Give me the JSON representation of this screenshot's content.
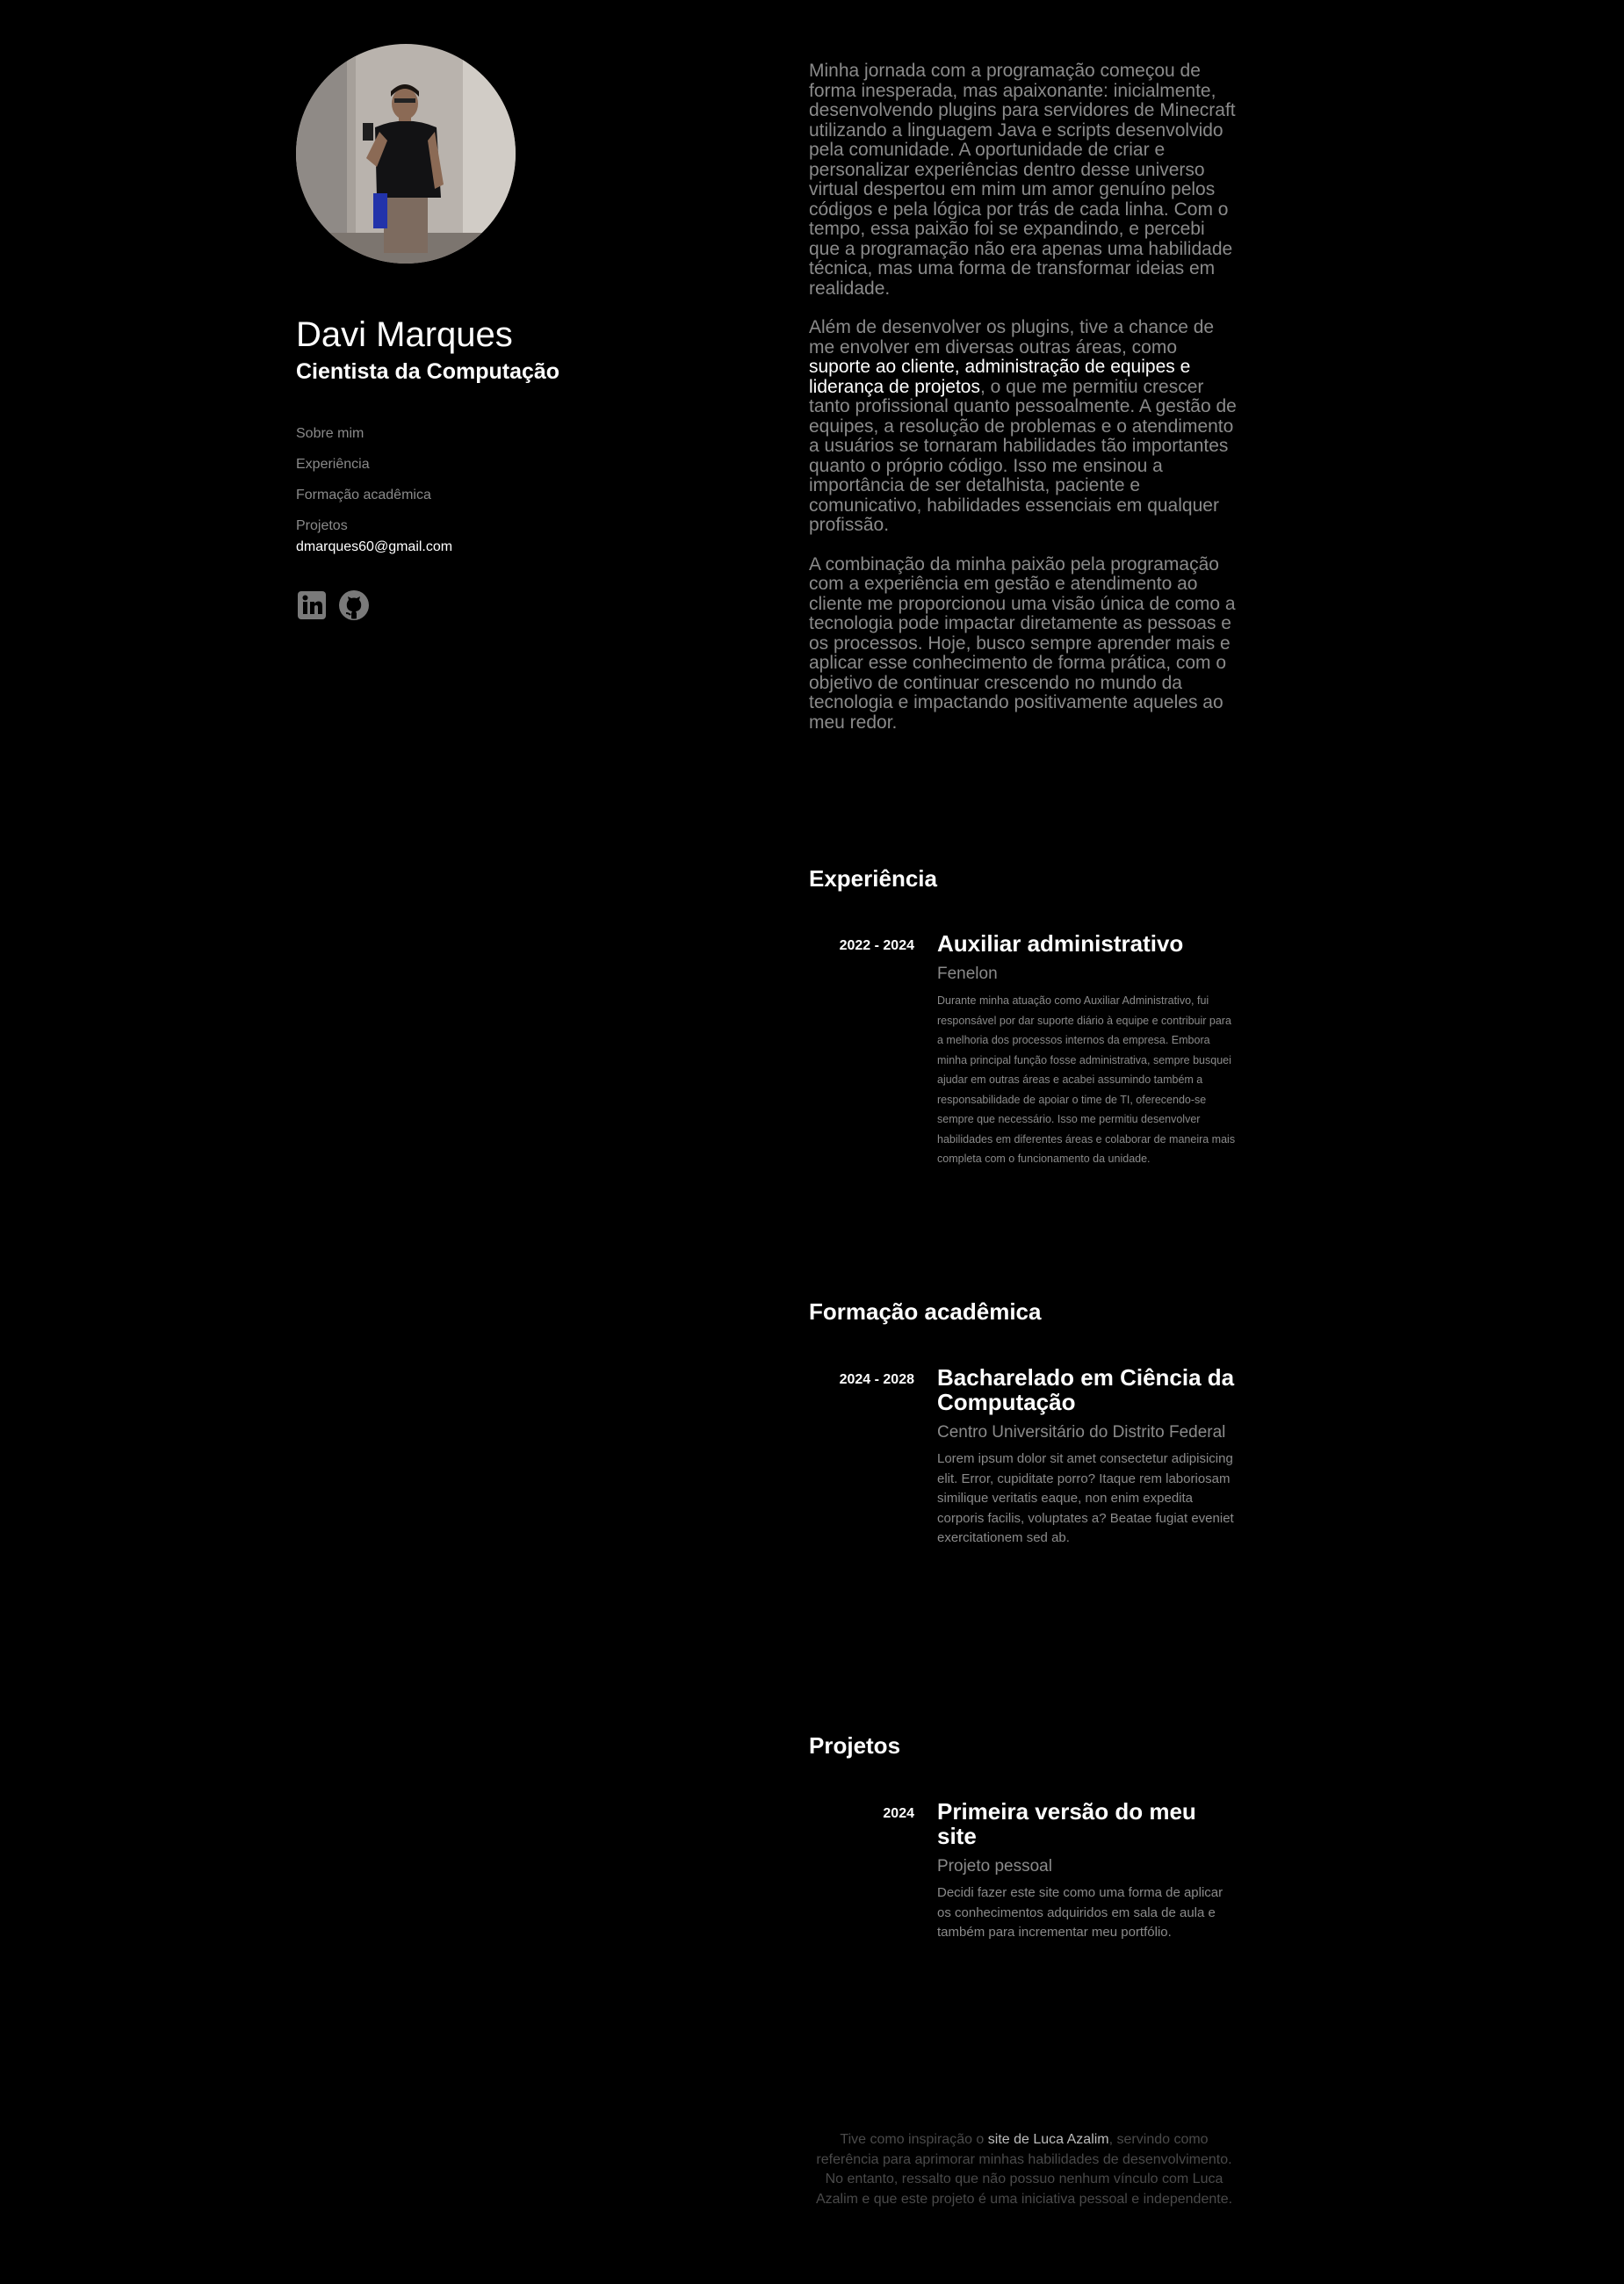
{
  "profile": {
    "name": "Davi Marques",
    "role": "Cientista da Computação",
    "email": "dmarques60@gmail.com"
  },
  "nav": {
    "items": [
      {
        "label": "Sobre mim"
      },
      {
        "label": "Experiência"
      },
      {
        "label": "Formação acadêmica"
      },
      {
        "label": "Projetos"
      }
    ]
  },
  "socials": [
    {
      "icon": "linkedin-icon"
    },
    {
      "icon": "github-icon"
    }
  ],
  "about": {
    "p1": "Minha jornada com a programação começou de forma inesperada, mas apaixonante: inicialmente, desenvolvendo plugins para servidores de Minecraft utilizando a linguagem Java e scripts desenvolvido pela comunidade. A oportunidade de criar e personalizar experiências dentro desse universo virtual despertou em mim um amor genuíno pelos códigos e pela lógica por trás de cada linha. Com o tempo, essa paixão foi se expandindo, e percebi que a programação não era apenas uma habilidade técnica, mas uma forma de transformar ideias em realidade.",
    "p2_start": "Além de desenvolver os plugins, tive a chance de me envolver em diversas outras áreas, como ",
    "p2_highlight": "suporte ao cliente, administração de equipes e liderança de projetos",
    "p2_end": ", o que me permitiu crescer tanto profissional quanto pessoalmente. A gestão de equipes, a resolução de problemas e o atendimento a usuários se tornaram habilidades tão importantes quanto o próprio código. Isso me ensinou a importância de ser detalhista, paciente e comunicativo, habilidades essenciais em qualquer profissão.",
    "p3": "A combinação da minha paixão pela programação com a experiência em gestão e atendimento ao cliente me proporcionou uma visão única de como a tecnologia pode impactar diretamente as pessoas e os processos. Hoje, busco sempre aprender mais e aplicar esse conhecimento de forma prática, com o objetivo de continuar crescendo no mundo da tecnologia e impactando positivamente aqueles ao meu redor."
  },
  "experience": {
    "heading": "Experiência",
    "items": [
      {
        "period": "2022 - 2024",
        "title": "Auxiliar administrativo",
        "org": "Fenelon",
        "desc": "Durante minha atuação como Auxiliar Administrativo, fui responsável por dar suporte diário à equipe e contribuir para a melhoria dos processos internos da empresa. Embora minha principal função fosse administrativa, sempre busquei ajudar em outras áreas e acabei assumindo também a responsabilidade de apoiar o time de TI, oferecendo-se sempre que necessário. Isso me permitiu desenvolver habilidades em diferentes áreas e colaborar de maneira mais completa com o funcionamento da unidade."
      }
    ]
  },
  "education": {
    "heading": "Formação acadêmica",
    "items": [
      {
        "period": "2024 - 2028",
        "title": "Bacharelado em Ciência da Computação",
        "org": "Centro Universitário do Distrito Federal",
        "desc": "Lorem ipsum dolor sit amet consectetur adipisicing elit. Error, cupiditate porro? Itaque rem laboriosam similique veritatis eaque, non enim expedita corporis facilis, voluptates a? Beatae fugiat eveniet exercitationem sed ab."
      }
    ]
  },
  "projects": {
    "heading": "Projetos",
    "items": [
      {
        "period": "2024",
        "title": "Primeira versão do meu site",
        "org": "Projeto pessoal",
        "desc": "Decidi fazer este site como uma forma de aplicar os conhecimentos adquiridos em sala de aula e também para incrementar meu portfólio."
      }
    ]
  },
  "footer": {
    "start": "Tive como inspiração o ",
    "link": "site de Luca Azalim",
    "end": ", servindo como referência para aprimorar minhas habilidades de desenvolvimento. No entanto, ressalto que não possuo nenhum vínculo com Luca Azalim e que este projeto é uma iniciativa pessoal e independente."
  },
  "colors": {
    "background": "#000000",
    "text_primary": "#ffffff",
    "text_muted": "#8a8a8a",
    "footer_text": "#4a4a4a"
  }
}
